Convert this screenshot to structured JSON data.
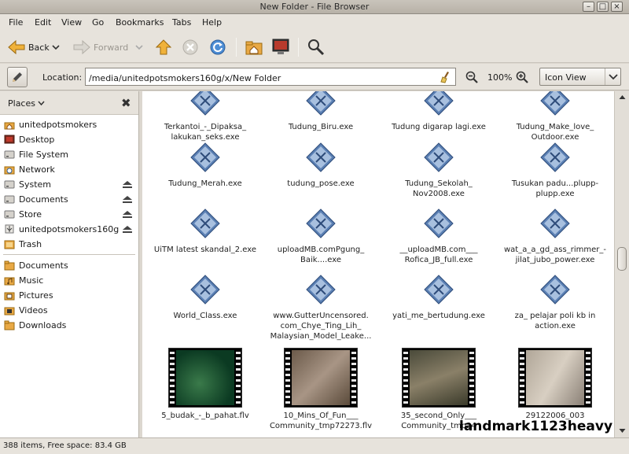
{
  "window": {
    "title": "New Folder - File Browser"
  },
  "menu": [
    "File",
    "Edit",
    "View",
    "Go",
    "Bookmarks",
    "Tabs",
    "Help"
  ],
  "toolbar": {
    "back": "Back",
    "forward": "Forward"
  },
  "location": {
    "label": "Location:",
    "path": "/media/unitedpotsmokers160g/x/New Folder",
    "zoom": "100%",
    "view": "Icon View"
  },
  "sidebar": {
    "header": "Places",
    "places": [
      {
        "label": "unitedpotsmokers",
        "icon": "home-icon"
      },
      {
        "label": "Desktop",
        "icon": "desktop-icon"
      },
      {
        "label": "File System",
        "icon": "drive-icon"
      },
      {
        "label": "Network",
        "icon": "network-icon"
      },
      {
        "label": "System",
        "icon": "drive-icon"
      },
      {
        "label": "Documents",
        "icon": "drive-icon"
      },
      {
        "label": "Store",
        "icon": "drive-icon"
      },
      {
        "label": "unitedpotsmokers160g",
        "icon": "usb-icon"
      },
      {
        "label": "Trash",
        "icon": "trash-icon"
      }
    ],
    "bookmarks": [
      {
        "label": "Documents",
        "icon": "folder-icon"
      },
      {
        "label": "Music",
        "icon": "music-folder-icon"
      },
      {
        "label": "Pictures",
        "icon": "pictures-folder-icon"
      },
      {
        "label": "Videos",
        "icon": "video-folder-icon"
      },
      {
        "label": "Downloads",
        "icon": "folder-icon"
      }
    ]
  },
  "files": [
    {
      "name": "Terkantoi_-_Dipaksa_\nlakukan_seks.exe",
      "type": "exe"
    },
    {
      "name": "Tudung_Biru.exe",
      "type": "exe"
    },
    {
      "name": "Tudung digarap lagi.exe",
      "type": "exe"
    },
    {
      "name": "Tudung_Make_love_\nOutdoor.exe",
      "type": "exe"
    },
    {
      "name": "Tudung_Merah.exe",
      "type": "exe"
    },
    {
      "name": "tudung_pose.exe",
      "type": "exe"
    },
    {
      "name": "Tudung_Sekolah_\nNov2008.exe",
      "type": "exe"
    },
    {
      "name": "Tusukan padu...plupp-\nplupp.exe",
      "type": "exe"
    },
    {
      "name": "UiTM latest skandal_2.exe",
      "type": "exe"
    },
    {
      "name": "uploadMB.comPgung_\nBaik....exe",
      "type": "exe"
    },
    {
      "name": "__uploadMB.com___\nRofica_JB_full.exe",
      "type": "exe"
    },
    {
      "name": "wat_a_a_gd_ass_rimmer_-\njilat_jubo_power.exe",
      "type": "exe"
    },
    {
      "name": "World_Class.exe",
      "type": "exe"
    },
    {
      "name": "www.GutterUncensored.\ncom_Chye_Ting_Lih_\nMalaysian_Model_Leake...",
      "type": "exe"
    },
    {
      "name": "yati_me_bertudung.exe",
      "type": "exe"
    },
    {
      "name": "za_ pelajar poli kb in\naction.exe",
      "type": "exe"
    },
    {
      "name": "5_budak_-_b_pahat.flv",
      "type": "video"
    },
    {
      "name": "10_Mins_Of_Fun___\nCommunity_tmp72273.flv",
      "type": "video"
    },
    {
      "name": "35_second_Only___\nCommunity_tmp24",
      "type": "video"
    },
    {
      "name": "29122006_003",
      "type": "video"
    }
  ],
  "status": {
    "text": "388 items, Free space: 83.4 GB"
  },
  "watermark": "landmark1123heavy"
}
